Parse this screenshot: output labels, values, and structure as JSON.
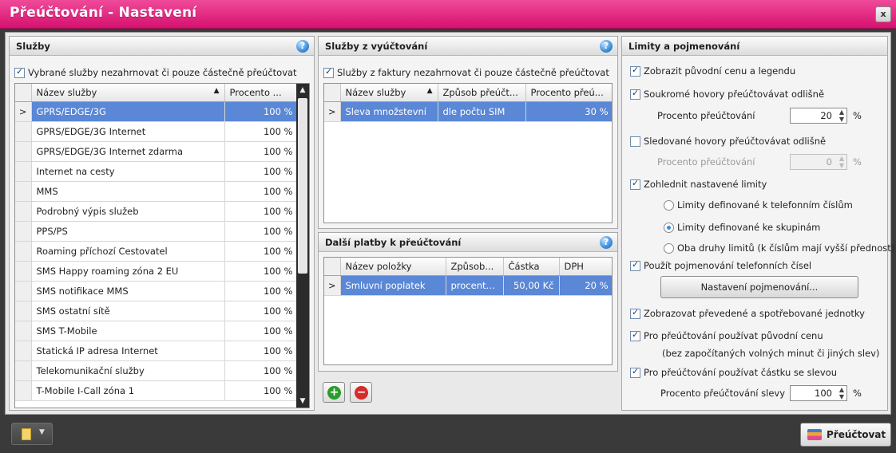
{
  "window": {
    "title": "Přeúčtování - Nastavení",
    "close_label": "x"
  },
  "services_panel": {
    "title": "Služby",
    "checkbox_label": "Vybrané služby nezahrnovat či pouze částečně přeúčtovat",
    "checked": true,
    "columns": [
      "Název služby",
      "Procento ..."
    ],
    "rows": [
      {
        "name": "GPRS/EDGE/3G",
        "percent": "100 %"
      },
      {
        "name": "GPRS/EDGE/3G Internet",
        "percent": "100 %"
      },
      {
        "name": "GPRS/EDGE/3G Internet zdarma",
        "percent": "100 %"
      },
      {
        "name": "Internet na cesty",
        "percent": "100 %"
      },
      {
        "name": "MMS",
        "percent": "100 %"
      },
      {
        "name": "Podrobný výpis služeb",
        "percent": "100 %"
      },
      {
        "name": "PPS/PS",
        "percent": "100 %"
      },
      {
        "name": "Roaming příchozí Cestovatel",
        "percent": "100 %"
      },
      {
        "name": "SMS Happy roaming zóna 2 EU",
        "percent": "100 %"
      },
      {
        "name": "SMS notifikace MMS",
        "percent": "100 %"
      },
      {
        "name": "SMS ostatní sítě",
        "percent": "100 %"
      },
      {
        "name": "SMS T-Mobile",
        "percent": "100 %"
      },
      {
        "name": "Statická IP adresa Internet",
        "percent": "100 %"
      },
      {
        "name": "Telekomunikační služby",
        "percent": "100 %"
      },
      {
        "name": "T-Mobile I-Call zóna 1",
        "percent": "100 %"
      }
    ]
  },
  "billing_panel": {
    "title": "Služby z vyúčtování",
    "checkbox_label": "Služby z faktury nezahrnovat či pouze částečně přeúčtovat",
    "checked": true,
    "columns": [
      "Název služby",
      "Způsob přeúčt...",
      "Procento přeú..."
    ],
    "rows": [
      {
        "name": "Sleva množstevní",
        "method": "dle počtu SIM",
        "percent": "30 %"
      }
    ]
  },
  "extra_panel": {
    "title": "Další platby k přeúčtování",
    "columns": [
      "Název položky",
      "Způsob...",
      "Částka",
      "DPH"
    ],
    "rows": [
      {
        "name": "Smluvní poplatek",
        "method": "procent...",
        "amount": "50,00 Kč",
        "vat": "20 %"
      }
    ]
  },
  "limits_panel": {
    "title": "Limity a pojmenování",
    "show_original_price": "Zobrazit původní cenu a legendu",
    "private_calls": "Soukromé hovory přeúčtovávat odlišně",
    "private_percent_label": "Procento přeúčtování",
    "private_percent_value": "20",
    "monitored_calls": "Sledované hovory přeúčtovávat odlišně",
    "monitored_percent_label": "Procento přeúčtování",
    "monitored_percent_value": "0",
    "respect_limits": "Zohlednit nastavené limity",
    "radio_phone_limits": "Limity definované k telefonním číslům",
    "radio_group_limits": "Limity definované ke skupinám",
    "radio_both_limits": "Oba druhy limitů (k číslům mají vyšší přednost)",
    "use_phone_names": "Použít pojmenování telefonních čísel",
    "naming_button": "Nastavení pojmenování...",
    "show_units": "Zobrazovat převedené a spotřebované jednotky",
    "use_original_price": "Pro přeúčtování používat původní cenu",
    "use_original_price_note": "(bez započítaných volných minut či jiných slev)",
    "use_discount_amount": "Pro přeúčtování používat částku se slevou",
    "discount_percent_label": "Procento přeúčtování slevy",
    "discount_percent_value": "100",
    "percent_unit": "%"
  },
  "footer": {
    "primary_button": "Přeúčtovat"
  }
}
